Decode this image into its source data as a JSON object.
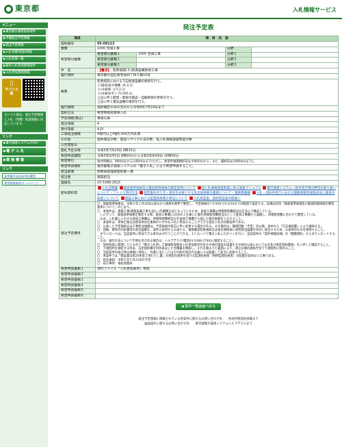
{
  "header": {
    "logo_text": "東京都",
    "site_title": "入札情報サービス"
  },
  "sidebar": {
    "menu_header": "メニュー",
    "items": [
      "▶東京都公報等発表案件",
      "▶予備発注予定情報",
      "▶発注予定情報",
      "▶入札見積(経過)情報",
      "▶入札結果一覧",
      "▶競争入札参加資格案件",
      "▶入札参加資格情報"
    ],
    "mobile_label": "モバイル版",
    "mobile_note": "モバイル版は、発注予定情報と入札（見積）経過情報に対応しています。",
    "links_header": "リンク",
    "big_items": [
      "▶電子調達システム(TOP)",
      "▶電 子 入 札",
      "▶資 格 審 査"
    ],
    "site_links_header": "リンク",
    "site_links": [
      "東京電子自治体共同運営",
      "東京都財務局ホームページ"
    ]
  },
  "main": {
    "title": "発注予定表",
    "col_item": "項目",
    "col_content": "項　目　内　容",
    "rows": {
      "contract_no_label": "契約番号",
      "contract_no": "05-00113",
      "type_label": "業種",
      "type": "1000 空調工事",
      "hope_label": "希望受付業種",
      "hope1_label": "希望受付業種１",
      "hope1": "1000 空調工事",
      "hope2_label": "希望受付業種２",
      "hope3_label": "希望受付業種３",
      "field_label": "分野",
      "field1_label": "分野１",
      "field2_label": "分野２",
      "field3_label": "分野３",
      "name_label": "件　名",
      "name_tag": "【電子】",
      "name": "荏原病院(５)熱源設備改修工事",
      "place_label": "履行場所",
      "place": "東京都大田区東雪谷四丁目５番10号",
      "summary_label": "概要",
      "summary_lines": [
        "荏原病院における下記熱源設備の更新を行う。",
        "１)吸収式冷凍機（R-2,3）",
        "２)冷却塔（CT-2,3）",
        "３)冷却水ポンプ(CDP-3)",
        "上記に伴う配管・配管付属品・自動制御の更新を行う。",
        "上記に伴う電気設備の更新を行う。"
      ],
      "period_label": "履行期間",
      "period": "契約確定の日の翌日から令和8年7月18日まで",
      "method_label": "契約方法",
      "method": "希望制指名競争入札",
      "budget_label": "予定価格(税込)",
      "budget": "事後公表",
      "rank_label": "発注等級",
      "rank": "A",
      "office_label": "受付等級",
      "office": "A,JV",
      "scale_label": "工事発注規模",
      "scale": "4億円以上4億5,000万円未満",
      "other_label": "その他",
      "other": "契約保証対象、建設リサイクル法対象、低入札価格調査制度対象",
      "announce_label": "公告閲覧日",
      "announce": "",
      "open_label": "開札予定日時",
      "open": "令和5年7月24日 9時15分",
      "accept_period_label": "希望申請期間",
      "accept_period": "令和5年6月5日 9時00分から令和5年6月9日 16時00分",
      "accept_method_label": "希望受付",
      "accept_method": "受付時間は、9時00分から21時00分まで(ただし、希望申請期間初日は９時00分から、また、最終日は16時00分まで)。",
      "dept_label": "希望申請場所",
      "dept": "東京都電子調達システムの「電子入札」により希望申請すること。",
      "section_label": "担当部課",
      "section": "財務局経理部契約第一課",
      "person_label": "担当者",
      "person": "建築担当",
      "tel_label": "連絡先",
      "tel": "03-5388-2623",
      "attach_label": "配布資料等",
      "attachments": [
        "入札説明書",
        "調査基準価格及び最低制限価格の算定基準について",
        "低入札価格調査制度に係る調査マニュアル",
        "電子調達システム一般手続き時の押印の取り扱いについて・ファイル添付方法",
        "指定書の作り方・受任を必要とする支店技術者の業務について・業務用書類",
        "入札・契約手続きにおける健康保険等保険未加入業者の取扱いについて",
        "建設工事における監理技術者の専任について",
        "入札保証金、契約保証金の取扱い"
      ],
      "remarks_label": "発注予定備考",
      "remarks": [
        "〇　調査基準価格は、令和５年１月16日公表分から適用の基準で算定し、予定価格の7.5/10から9.2/10までの範囲で設定する。詳細は別添「調査基準価格及び最低制限価格の算定基準について」のとおり。",
        "〇　本案件は、建築工事(建築設備工事を含む。)の積算方式となっているため、直接工事費は現場管理費相当分を含んで構成している。",
        "　したがって、調査基準価格を算定する際、直接工事費に10分の１を乗じた額を現場管理費相当分として直接工事費から減額し、現場管理費に合わせて算定している。",
        "　なお、入札書に入力する直接工事費は、現場管理費相当分を直接工事費から減じた額の総額を入力すること。",
        "〇　本案件は、単体企業又は経常共同企業体のいずれも入札に参加することができる混合入札の対象案件である。",
        "〇　公表した予定価格又は工事発注規模は、予定価格の修正に伴い変更する場合がある。その場合は、最終回数（予定）日以降、途中から「訂正通知書」により通知する。",
        "〇　回線、携帯の内訳書等の発注図書を、案件公表時から公表する。資格確認結果通知又は指名通知後に原則発注図書を添付し提出するため、公表時のものを使用すること。",
        "　ダウンロードは、当該案件に参加できる者のみが行うことができる。ＩＣカードで電子入札にログインを行い、当該案件の「案件情報詳細」の「積算資料」からダウンロードすること。",
        "　なお、操作方法について不明な点がある場合は、ヘルプデスク(電話03-5388-2790)に確認すること。",
        "〇　契約制度に関連しているので「電子入札用」工事請負等競争入札参加者待合室その他の施設の設置をその他の公表においてもの及び委託契約関係」を入手して確認すること。",
        "〇　下請契約を締結する時は、法定福利費を別枠表記した見積書を徴取し、それを踏まえた書面により、適正な額の請負代金で下請契約に努めること。",
        "〇　当該案件の施工時は現場に常駐し、作業に当たってはその他の周辺の交通に十分配慮して安全に実施すること。",
        "〇　本案件では「建設業法第26条第３項ただし書」の規定の適用を受ける監理技術者（特例監理技術者）の配置を認めない工事である。",
        "〇　指名通知：令和５年６月21日の予定",
        "〇　前工事等：福祉保健局"
      ],
      "doc_label": "希望申請書類",
      "doc1_label": "希望申請書類１",
      "doc1": "添付ファイル「入札参加条件」参照"
    },
    "back_button": "案件一覧画面へ戻る"
  },
  "footer": {
    "line1": "発注予定情報に掲載されている各案件に関するお問い合わせ先　　各局所管契約部署まで",
    "line2": "画面操作に関するお問い合わせ先　　東京都電子調達システムヘルプデスクまで"
  }
}
